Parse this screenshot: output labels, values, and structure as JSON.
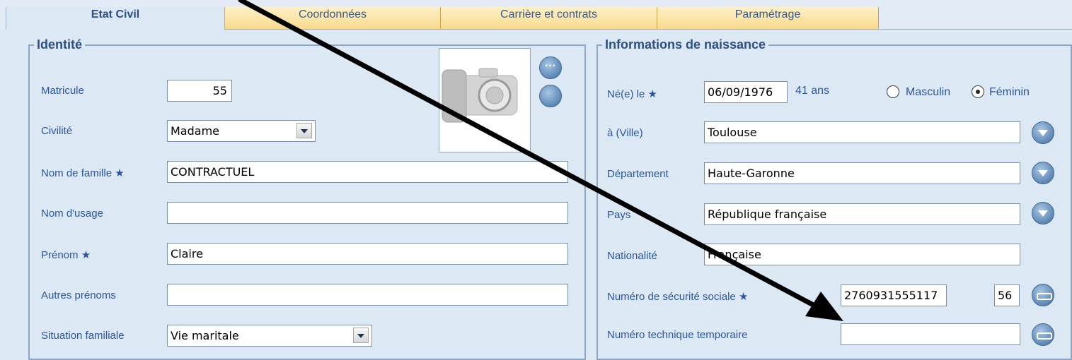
{
  "tabs": [
    {
      "label": "Etat Civil",
      "active": true
    },
    {
      "label": "Coordonnées",
      "active": false
    },
    {
      "label": "Carrière et contrats",
      "active": false
    },
    {
      "label": "Paramétrage",
      "active": false
    }
  ],
  "identite": {
    "title": "Identité",
    "matricule_label": "Matricule",
    "matricule_value": "55",
    "civilite_label": "Civilité",
    "civilite_value": "Madame",
    "nom_famille_label": "Nom de famille",
    "nom_famille_value": "CONTRACTUEL",
    "nom_usage_label": "Nom d'usage",
    "nom_usage_value": "",
    "prenom_label": "Prénom",
    "prenom_value": "Claire",
    "autres_prenoms_label": "Autres prénoms",
    "autres_prenoms_value": "",
    "situation_label": "Situation familiale",
    "situation_value": "Vie maritale",
    "required_mark": "★"
  },
  "naissance": {
    "title": "Informations de naissance",
    "date_label": "Né(e) le",
    "date_value": "06/09/1976",
    "age_text": "41 ans",
    "masculin_label": "Masculin",
    "feminin_label": "Féminin",
    "selected_gender": "Féminin",
    "ville_label": "à (Ville)",
    "ville_value": "Toulouse",
    "departement_label": "Département",
    "departement_value": "Haute-Garonne",
    "pays_label": "Pays",
    "pays_value": "République française",
    "nationalite_label": "Nationalité",
    "nationalite_value": "Française",
    "secu_label": "Numéro de sécurité sociale",
    "secu_value": "2760931555117",
    "secu_key": "56",
    "ntt_label": "Numéro technique temporaire",
    "ntt_value": "",
    "required_mark": "★"
  },
  "colors": {
    "background": "#dde8f5",
    "label_blue": "#2a56a0",
    "tab_gold": "#f8d98b",
    "arrow": "#000000"
  },
  "icons": [
    "more-options-icon",
    "chevron-down-icon",
    "key-icon",
    "camera-placeholder-icon"
  ]
}
